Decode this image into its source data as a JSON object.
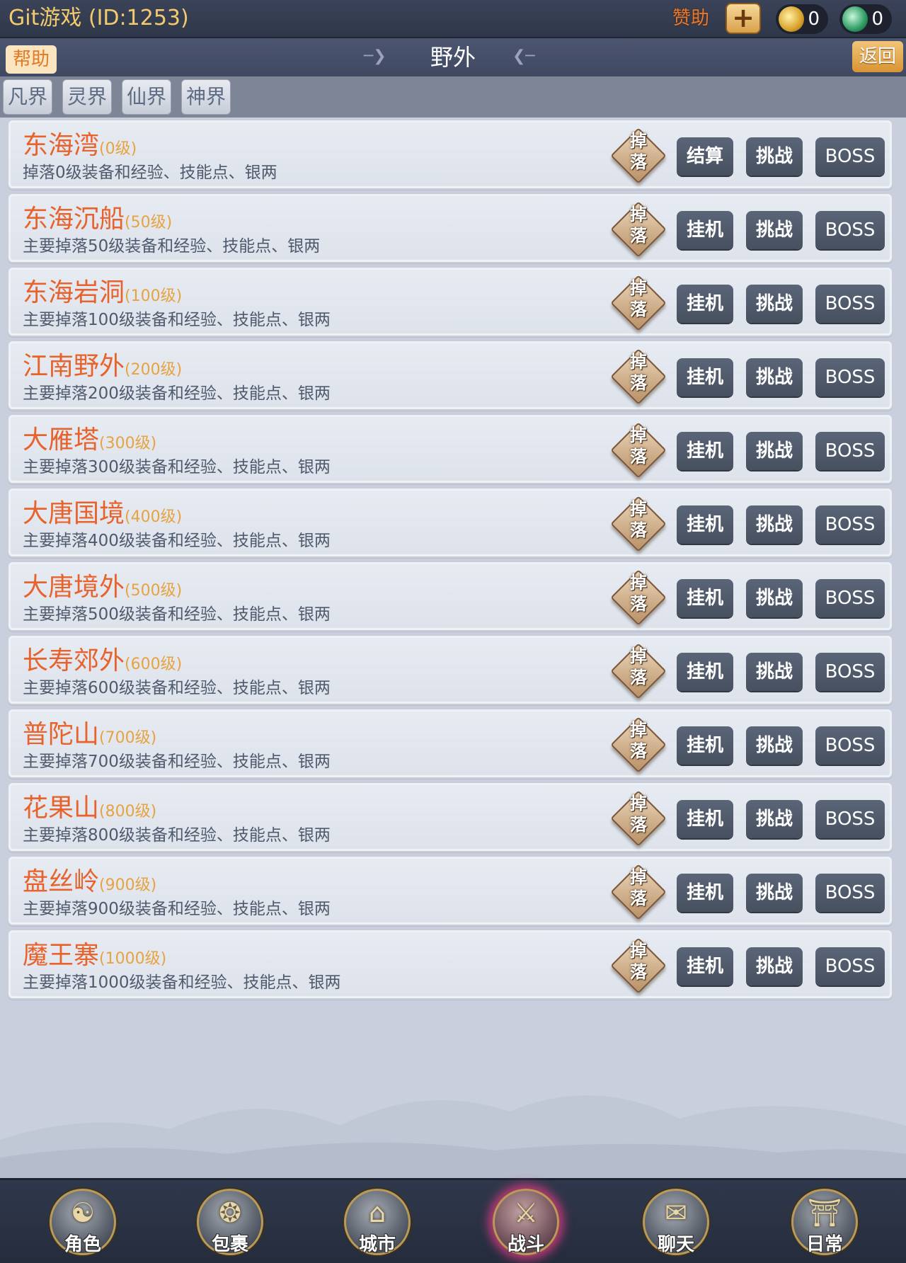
{
  "topbar": {
    "title": "Git游戏 (ID:1253)",
    "sponsor_label": "赞助",
    "plus_label": "+",
    "gold_value": "0",
    "jade_value": "0",
    "gold_icon": "gold-coin-icon",
    "jade_icon": "jade-coin-icon"
  },
  "header": {
    "help_label": "帮助",
    "title": "野外",
    "back_label": "返回"
  },
  "tabs": [
    {
      "label": "凡界"
    },
    {
      "label": "灵界"
    },
    {
      "label": "仙界"
    },
    {
      "label": "神界"
    }
  ],
  "maps": [
    {
      "name": "东海湾",
      "level": "(0级)",
      "desc": "掉落0级装备和经验、技能点、银两",
      "drop": "掉落",
      "action1": "结算",
      "action2": "挑战",
      "action3": "BOSS"
    },
    {
      "name": "东海沉船",
      "level": "(50级)",
      "desc": "主要掉落50级装备和经验、技能点、银两",
      "drop": "掉落",
      "action1": "挂机",
      "action2": "挑战",
      "action3": "BOSS"
    },
    {
      "name": "东海岩洞",
      "level": "(100级)",
      "desc": "主要掉落100级装备和经验、技能点、银两",
      "drop": "掉落",
      "action1": "挂机",
      "action2": "挑战",
      "action3": "BOSS"
    },
    {
      "name": "江南野外",
      "level": "(200级)",
      "desc": "主要掉落200级装备和经验、技能点、银两",
      "drop": "掉落",
      "action1": "挂机",
      "action2": "挑战",
      "action3": "BOSS"
    },
    {
      "name": "大雁塔",
      "level": "(300级)",
      "desc": "主要掉落300级装备和经验、技能点、银两",
      "drop": "掉落",
      "action1": "挂机",
      "action2": "挑战",
      "action3": "BOSS"
    },
    {
      "name": "大唐国境",
      "level": "(400级)",
      "desc": "主要掉落400级装备和经验、技能点、银两",
      "drop": "掉落",
      "action1": "挂机",
      "action2": "挑战",
      "action3": "BOSS"
    },
    {
      "name": "大唐境外",
      "level": "(500级)",
      "desc": "主要掉落500级装备和经验、技能点、银两",
      "drop": "掉落",
      "action1": "挂机",
      "action2": "挑战",
      "action3": "BOSS"
    },
    {
      "name": "长寿郊外",
      "level": "(600级)",
      "desc": "主要掉落600级装备和经验、技能点、银两",
      "drop": "掉落",
      "action1": "挂机",
      "action2": "挑战",
      "action3": "BOSS"
    },
    {
      "name": "普陀山",
      "level": "(700级)",
      "desc": "主要掉落700级装备和经验、技能点、银两",
      "drop": "掉落",
      "action1": "挂机",
      "action2": "挑战",
      "action3": "BOSS"
    },
    {
      "name": "花果山",
      "level": "(800级)",
      "desc": "主要掉落800级装备和经验、技能点、银两",
      "drop": "掉落",
      "action1": "挂机",
      "action2": "挑战",
      "action3": "BOSS"
    },
    {
      "name": "盘丝岭",
      "level": "(900级)",
      "desc": "主要掉落900级装备和经验、技能点、银两",
      "drop": "掉落",
      "action1": "挂机",
      "action2": "挑战",
      "action3": "BOSS"
    },
    {
      "name": "魔王寨",
      "level": "(1000级)",
      "desc": "主要掉落1000级装备和经验、技能点、银两",
      "drop": "掉落",
      "action1": "挂机",
      "action2": "挑战",
      "action3": "BOSS"
    }
  ],
  "nav": [
    {
      "label": "角色",
      "icon": "character-icon",
      "active": false
    },
    {
      "label": "包裹",
      "icon": "bag-icon",
      "active": false
    },
    {
      "label": "城市",
      "icon": "city-icon",
      "active": false
    },
    {
      "label": "战斗",
      "icon": "battle-icon",
      "active": true
    },
    {
      "label": "聊天",
      "icon": "chat-icon",
      "active": false
    },
    {
      "label": "日常",
      "icon": "daily-icon",
      "active": false
    }
  ]
}
